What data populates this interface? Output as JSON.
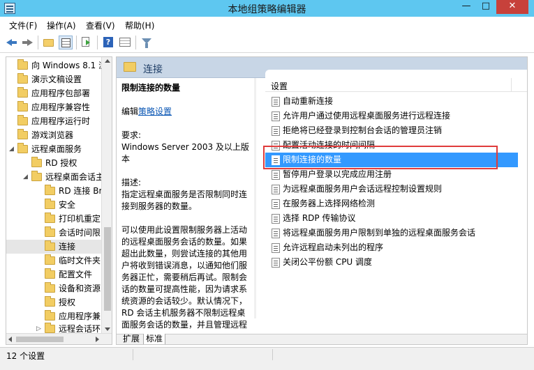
{
  "window": {
    "title": "本地组策略编辑器",
    "minimize": "—",
    "maximize": "□",
    "close": "✕"
  },
  "menu": [
    "文件(F)",
    "操作(A)",
    "查看(V)",
    "帮助(H)"
  ],
  "toolbar": [
    "back-icon",
    "forward-icon",
    "up-folder-icon",
    "show-hide-tree-icon",
    "export-list-icon",
    "help-icon",
    "properties-icon",
    "filter-icon"
  ],
  "tree": {
    "items": [
      {
        "label": "向 Windows 8.1 浏",
        "expander": "",
        "selected": false
      },
      {
        "label": "演示文稿设置",
        "expander": "",
        "selected": false
      },
      {
        "label": "应用程序包部署",
        "expander": "",
        "selected": false
      },
      {
        "label": "应用程序兼容性",
        "expander": "",
        "selected": false
      },
      {
        "label": "应用程序运行时",
        "expander": "",
        "selected": false
      },
      {
        "label": "游戏浏览器",
        "expander": "",
        "selected": false
      },
      {
        "label": "远程桌面服务",
        "expander": "◢",
        "selected": false
      },
      {
        "label": "RD 授权",
        "expander": "",
        "selected": false
      },
      {
        "label": "远程桌面会话主",
        "expander": "◢",
        "selected": false
      },
      {
        "label": "RD 连接 Br",
        "expander": "",
        "selected": false
      },
      {
        "label": "安全",
        "expander": "",
        "selected": false
      },
      {
        "label": "打印机重定",
        "expander": "",
        "selected": false
      },
      {
        "label": "会话时间限",
        "expander": "",
        "selected": false
      },
      {
        "label": "连接",
        "expander": "",
        "selected": true
      },
      {
        "label": "临时文件夹",
        "expander": "",
        "selected": false
      },
      {
        "label": "配置文件",
        "expander": "",
        "selected": false
      },
      {
        "label": "设备和资源",
        "expander": "",
        "selected": false
      },
      {
        "label": "授权",
        "expander": "",
        "selected": false
      },
      {
        "label": "应用程序兼",
        "expander": "",
        "selected": false
      },
      {
        "label": "远程会话环",
        "expander": "▷",
        "selected": false
      }
    ]
  },
  "header": {
    "title": "连接"
  },
  "description": {
    "policy_title": "限制连接的数量",
    "edit_prefix": "编辑",
    "edit_link": "策略设置",
    "requirements_label": "要求:",
    "requirements_text": "Windows Server 2003 及以上版本",
    "description_label": "描述:",
    "description_text": "指定远程桌面服务是否限制同时连接到服务器的数量。",
    "body_text": "可以使用此设置限制服务器上活动的远程桌面服务会话的数量。如果超出此数量，则尝试连接的其他用户将收到错误消息，以通知他们服务器正忙，需要稍后再试。限制会话的数量可提高性能，因为请求系统资源的会话较少。默认情况下，RD 会话主机服务器不限制远程桌面服务会话的数量，并且管理远程"
  },
  "list": {
    "column_header": "设置",
    "items": [
      {
        "label": "自动重新连接",
        "selected": false
      },
      {
        "label": "允许用户通过使用远程桌面服务进行远程连接",
        "selected": false
      },
      {
        "label": "拒绝将已经登录到控制台会话的管理员注销",
        "selected": false
      },
      {
        "label": "配置活动连接的时间间隔",
        "selected": false
      },
      {
        "label": "限制连接的数量",
        "selected": true
      },
      {
        "label": "暂停用户登录以完成应用注册",
        "selected": false
      },
      {
        "label": "为远程桌面服务用户会话远程控制设置规则",
        "selected": false
      },
      {
        "label": "在服务器上选择网络检测",
        "selected": false
      },
      {
        "label": "选择 RDP 传输协议",
        "selected": false
      },
      {
        "label": "将远程桌面服务用户限制到单独的远程桌面服务会话",
        "selected": false
      },
      {
        "label": "允许远程启动未列出的程序",
        "selected": false
      },
      {
        "label": "关闭公平份额 CPU 调度",
        "selected": false
      }
    ]
  },
  "tabs": [
    "扩展",
    "标准"
  ],
  "status": {
    "text": "12 个设置"
  },
  "colors": {
    "selection": "#3399ff",
    "highlight_box": "#e03b3b",
    "title_bar": "#5ec7f0",
    "header_band": "#c8d6e6"
  }
}
